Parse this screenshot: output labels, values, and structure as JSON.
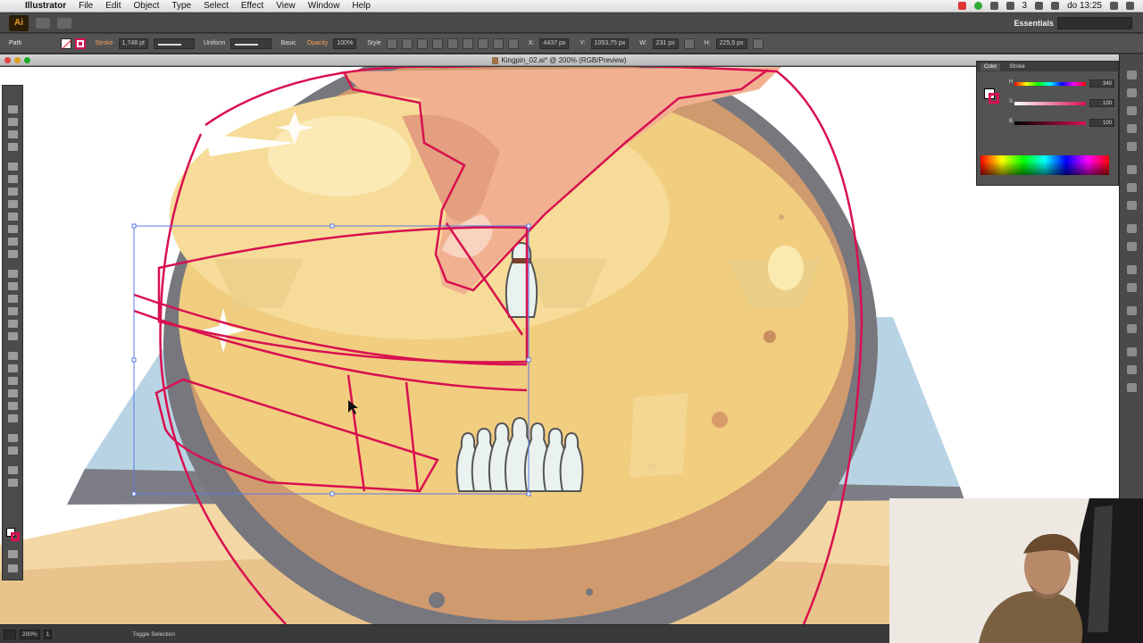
{
  "menubar": {
    "app_name": "Illustrator",
    "items": [
      "File",
      "Edit",
      "Object",
      "Type",
      "Select",
      "Effect",
      "View",
      "Window",
      "Help"
    ],
    "battery": "3",
    "clock": "do 13:25"
  },
  "appbar": {
    "logo": "Ai",
    "workspace": "Essentials"
  },
  "control_bar": {
    "selection": "Path",
    "stroke_label": "Stroke",
    "stroke_weight": "1,748 pt",
    "profile": "Uniform",
    "brush": "Basic",
    "opacity_label": "Opacity",
    "opacity_value": "100%",
    "style_label": "Style",
    "x_value": "4437 px",
    "y_value": "1053,75 px",
    "w_value": "231 px",
    "h_value": "225,5 px"
  },
  "document": {
    "title": "Kingpin_02.ai* @ 200% (RGB/Preview)"
  },
  "color_panel": {
    "tab_color": "Color",
    "tab_stroke": "Stroke",
    "channels": [
      {
        "label": "H",
        "value": "340"
      },
      {
        "label": "S",
        "value": "100"
      },
      {
        "label": "B",
        "value": "100"
      }
    ]
  },
  "status_bar": {
    "zoom": "200%",
    "artboard": "1",
    "status_text": "Toggle Selection"
  },
  "colors": {
    "stroke_accent": "#d8104f",
    "selection_blue": "#5a78e8"
  },
  "icons": [
    "apple-icon",
    "selection-tool-icon",
    "pen-tool-icon",
    "type-tool-icon",
    "zoom-tool-icon",
    "hand-tool-icon"
  ]
}
